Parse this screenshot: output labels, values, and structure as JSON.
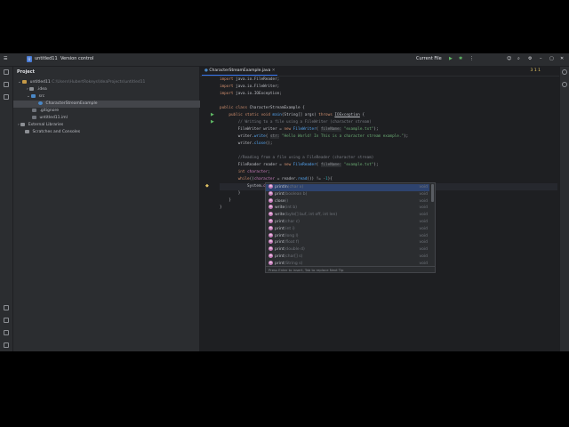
{
  "header": {
    "project_badge": "U",
    "project_name": "untitled11",
    "vcs": "Version control",
    "run_config": "Current File"
  },
  "project_panel": {
    "title": "Project",
    "tree": [
      {
        "label": "untitled11",
        "extra": "C:\\Users\\HubertRokeys\\IdeaProjects\\untitled11"
      },
      {
        "label": ".idea",
        "extra": ""
      },
      {
        "label": "src",
        "extra": ""
      },
      {
        "label": "CharacterStreamExample",
        "extra": ""
      },
      {
        "label": ".gitignore",
        "extra": ""
      },
      {
        "label": "untitled11.iml",
        "extra": ""
      },
      {
        "label": "External Libraries",
        "extra": ""
      },
      {
        "label": "Scratches and Consoles",
        "extra": ""
      }
    ]
  },
  "editor": {
    "tab_label": "CharacterStreamExample.java",
    "inspections": "3  1  1"
  },
  "completion": {
    "items": [
      {
        "name": "println",
        "params": "(char x)",
        "ret": "void"
      },
      {
        "name": "print",
        "params": "(boolean b)",
        "ret": "void"
      },
      {
        "name": "close",
        "params": "()",
        "ret": "void"
      },
      {
        "name": "write",
        "params": "(int b)",
        "ret": "void"
      },
      {
        "name": "write",
        "params": "(byte[] buf, int off, int len)",
        "ret": "void"
      },
      {
        "name": "print",
        "params": "(char c)",
        "ret": "void"
      },
      {
        "name": "print",
        "params": "(int i)",
        "ret": "void"
      },
      {
        "name": "print",
        "params": "(long l)",
        "ret": "void"
      },
      {
        "name": "print",
        "params": "(float f)",
        "ret": "void"
      },
      {
        "name": "print",
        "params": "(double d)",
        "ret": "void"
      },
      {
        "name": "print",
        "params": "(char[] s)",
        "ret": "void"
      },
      {
        "name": "print",
        "params": "(String s)",
        "ret": "void"
      }
    ],
    "footer": "Press Enter to insert, Tab to replace  Next Tip"
  }
}
